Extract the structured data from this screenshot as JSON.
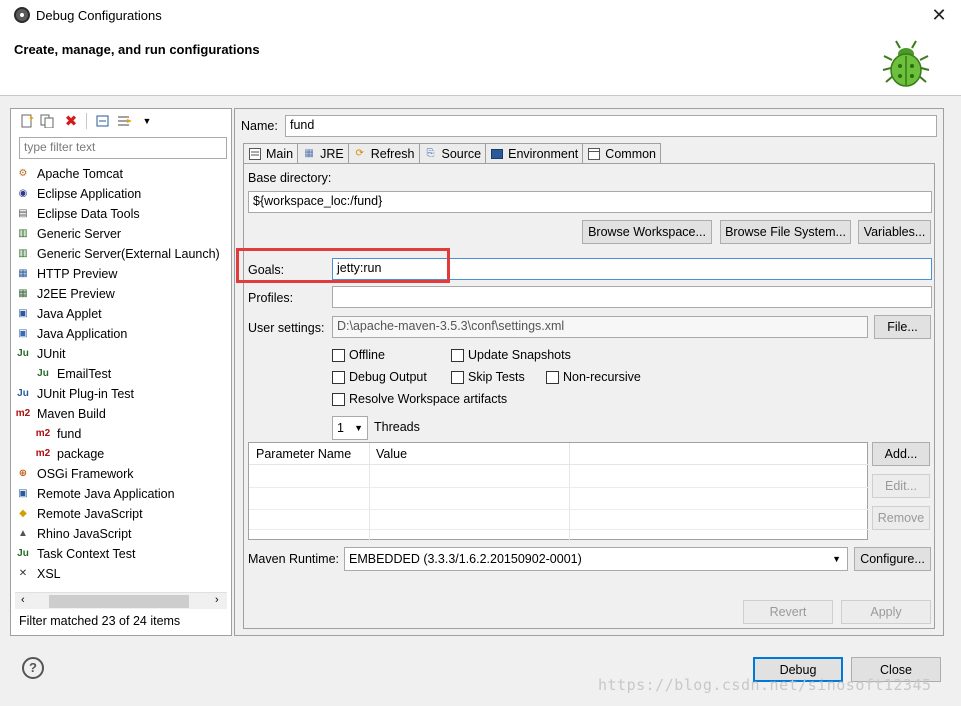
{
  "window": {
    "title": "Debug Configurations",
    "close_glyph": "✕"
  },
  "header": {
    "title": "Create, manage, and run configurations",
    "icon": "bug-icon"
  },
  "left": {
    "toolbar": [
      "new-config-icon",
      "duplicate-icon",
      "delete-icon",
      "collapse-all-icon",
      "filter-icon",
      "dropdown-arrow-icon"
    ],
    "filter_placeholder": "type filter text",
    "items": [
      {
        "label": "Apache Tomcat",
        "icon": "tomcat-icon",
        "sub": false
      },
      {
        "label": "Eclipse Application",
        "icon": "eclipse-icon",
        "sub": false
      },
      {
        "label": "Eclipse Data Tools",
        "icon": "database-icon",
        "sub": false
      },
      {
        "label": "Generic Server",
        "icon": "server-icon",
        "sub": false
      },
      {
        "label": "Generic Server(External Launch)",
        "icon": "server-icon",
        "sub": false
      },
      {
        "label": "HTTP Preview",
        "icon": "http-icon",
        "sub": false
      },
      {
        "label": "J2EE Preview",
        "icon": "j2ee-icon",
        "sub": false
      },
      {
        "label": "Java Applet",
        "icon": "applet-icon",
        "sub": false
      },
      {
        "label": "Java Application",
        "icon": "java-app-icon",
        "sub": false
      },
      {
        "label": "JUnit",
        "icon": "junit-icon",
        "sub": false
      },
      {
        "label": "EmailTest",
        "icon": "junit-icon",
        "sub": true
      },
      {
        "label": "JUnit Plug-in Test",
        "icon": "junit-plugin-icon",
        "sub": false
      },
      {
        "label": "Maven Build",
        "icon": "maven-icon",
        "sub": false
      },
      {
        "label": "fund",
        "icon": "maven-icon",
        "sub": true,
        "selected": true
      },
      {
        "label": "package",
        "icon": "maven-icon",
        "sub": true
      },
      {
        "label": "OSGi Framework",
        "icon": "osgi-icon",
        "sub": false
      },
      {
        "label": "Remote Java Application",
        "icon": "remote-java-icon",
        "sub": false
      },
      {
        "label": "Remote JavaScript",
        "icon": "remote-js-icon",
        "sub": false
      },
      {
        "label": "Rhino JavaScript",
        "icon": "rhino-icon",
        "sub": false
      },
      {
        "label": "Task Context Test",
        "icon": "task-context-icon",
        "sub": false
      },
      {
        "label": "XSL",
        "icon": "xsl-icon",
        "sub": false
      }
    ],
    "status": "Filter matched 23 of 24 items"
  },
  "right": {
    "name_label": "Name:",
    "name_value": "fund",
    "tabs": [
      {
        "label": "Main",
        "icon": "main-tab-icon",
        "active": true
      },
      {
        "label": "JRE",
        "icon": "jre-icon"
      },
      {
        "label": "Refresh",
        "icon": "refresh-icon"
      },
      {
        "label": "Source",
        "icon": "source-icon"
      },
      {
        "label": "Environment",
        "icon": "environment-icon"
      },
      {
        "label": "Common",
        "icon": "common-icon"
      }
    ],
    "main": {
      "base_dir_label": "Base directory:",
      "base_dir_value": "${workspace_loc:/fund}",
      "browse_workspace": "Browse Workspace...",
      "browse_fs": "Browse File System...",
      "variables": "Variables...",
      "goals_label": "Goals:",
      "goals_value": "jetty:run",
      "profiles_label": "Profiles:",
      "profiles_value": "",
      "user_settings_label": "User settings:",
      "user_settings_value": "D:\\apache-maven-3.5.3\\conf\\settings.xml",
      "file_btn": "File...",
      "checkboxes": {
        "offline": "Offline",
        "update_snapshots": "Update Snapshots",
        "debug_output": "Debug Output",
        "skip_tests": "Skip Tests",
        "non_recursive": "Non-recursive",
        "resolve_workspace": "Resolve Workspace artifacts"
      },
      "threads_value": "1",
      "threads_label": "Threads",
      "table_headers": [
        "Parameter Name",
        "Value"
      ],
      "add_btn": "Add...",
      "edit_btn": "Edit...",
      "remove_btn": "Remove",
      "runtime_label": "Maven Runtime:",
      "runtime_value": "EMBEDDED (3.3.3/1.6.2.20150902-0001)",
      "configure_btn": "Configure..."
    },
    "revert": "Revert",
    "apply": "Apply"
  },
  "footer": {
    "debug": "Debug",
    "close": "Close",
    "help_glyph": "?"
  },
  "watermark": "https://blog.csdn.net/sinosoft12345"
}
